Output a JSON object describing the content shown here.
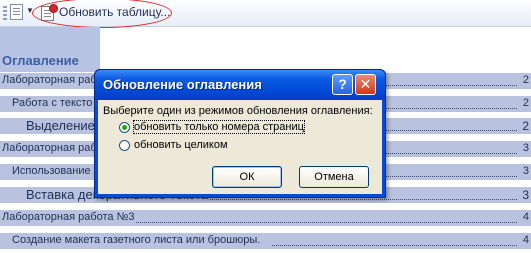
{
  "toolbar": {
    "update_table_label": "Обновить таблицу..."
  },
  "toc": {
    "heading": "Оглавление",
    "rows": [
      {
        "text": "Лабораторная раб",
        "page": "2"
      },
      {
        "text": "Работа с тексто",
        "page": "2"
      },
      {
        "text": "Выделение",
        "page": "2"
      },
      {
        "text": "Лабораторная рабо",
        "page": "3"
      },
      {
        "text": "Использование",
        "page": "3"
      },
      {
        "text": "Вставка декоративного текста",
        "page": "3"
      },
      {
        "text": "Лабораторная работа №3",
        "page": "4"
      },
      {
        "text": "Создание макета газетного листа или брошюры.",
        "page": "4"
      }
    ]
  },
  "dialog": {
    "title": "Обновление оглавления",
    "help_glyph": "?",
    "close_glyph": "✕",
    "prompt": "Выберите один из режимов обновления оглавления:",
    "options": [
      {
        "label": "обновить только номера страниц",
        "checked": true
      },
      {
        "label": "обновить целиком",
        "checked": false
      }
    ],
    "ok_label": "ОК",
    "cancel_label": "Отмена"
  },
  "colors": {
    "toc_highlight": "#b9c3df",
    "dialog_title": "#0048d4",
    "dialog_body": "#ece9d8",
    "annotation_ellipse": "#e3282b"
  }
}
